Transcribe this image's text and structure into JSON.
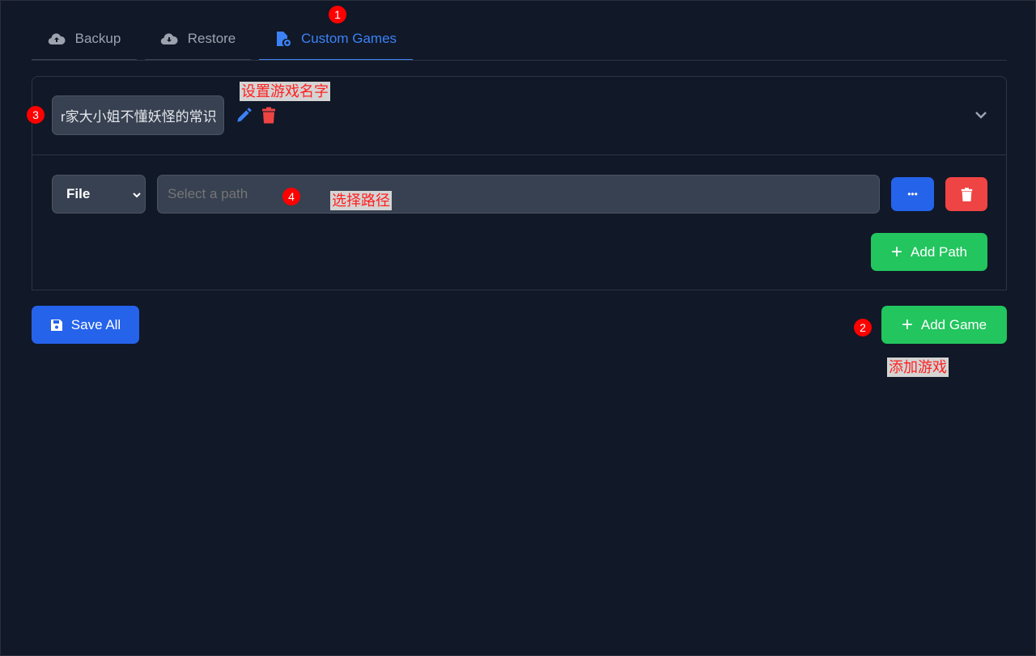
{
  "tabs": [
    {
      "label": "Backup",
      "icon": "cloud-upload-icon"
    },
    {
      "label": "Restore",
      "icon": "cloud-download-icon"
    },
    {
      "label": "Custom Games",
      "icon": "file-add-icon",
      "active": true
    }
  ],
  "game": {
    "name": "r家大小姐不懂妖怪的常识",
    "path_type": "File",
    "path_placeholder": "Select a path",
    "browse_label": "•••",
    "add_path_label": "Add Path"
  },
  "actions": {
    "save_all": "Save All",
    "add_game": "Add Game"
  },
  "annotations": {
    "m1": "1",
    "m2": "2",
    "m3": "3",
    "m4": "4",
    "set_name": "设置游戏名字",
    "select_path": "选择路径",
    "add_game": "添加游戏"
  },
  "colors": {
    "background": "#111827",
    "accent": "#3b82f6",
    "success": "#22c55e",
    "danger": "#ef4444"
  }
}
